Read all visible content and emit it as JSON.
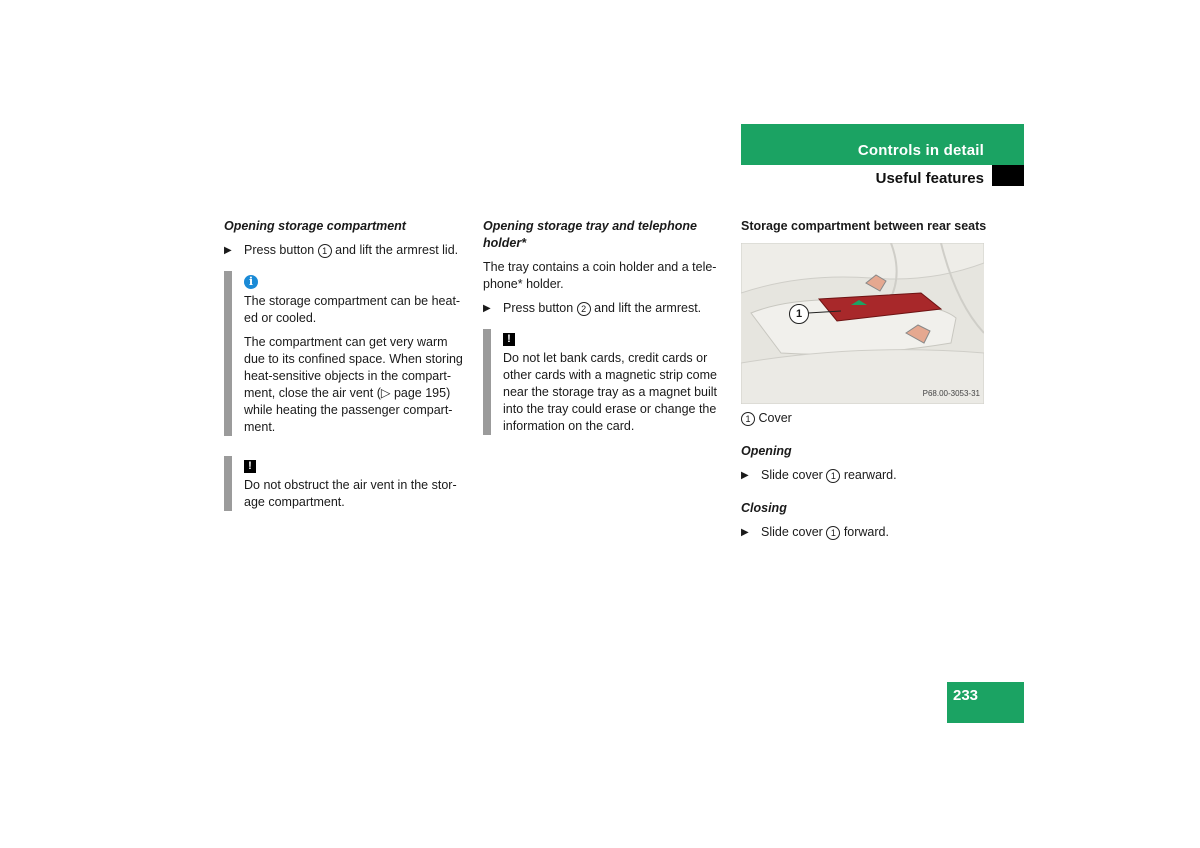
{
  "header": {
    "section": "Controls in detail",
    "subsection": "Useful features"
  },
  "column1": {
    "heading": "Opening storage compartment",
    "step1": {
      "before": "Press button",
      "num": "1",
      "after": "and lift the armrest lid."
    },
    "info_icon": "info-icon",
    "info_p1": "The storage compartment can be heat-ed or cooled.",
    "info_p2": "The compartment can get very warm due to its confined space. When storing heat-sensitive objects in the compart-ment, close the air vent (▷ page 195) while heating the passenger compart-ment.",
    "warning_icon": "!",
    "warning_text": "Do not obstruct the air vent in the stor-age compartment."
  },
  "column2": {
    "heading": "Opening storage tray and telephone holder*",
    "intro": "The tray contains a coin holder and a tele-phone* holder.",
    "step1": {
      "before": "Press button",
      "num": "2",
      "after": "and lift the armrest."
    },
    "warning_icon": "!",
    "warning_text": "Do not let bank cards, credit cards or other cards with a magnetic strip come near the storage tray as a magnet built into the tray could erase or change the information on the card."
  },
  "column3": {
    "heading": "Storage compartment between rear seats",
    "figure": {
      "callout": "1",
      "code": "P68.00-3053-31",
      "colors": {
        "cover": "#a8282a",
        "seat": "#e9e8e3",
        "symbol": "#1ba363"
      }
    },
    "legend": {
      "num": "1",
      "label": "Cover"
    },
    "opening_heading": "Opening",
    "opening_step": {
      "before": "Slide cover",
      "num": "1",
      "after": "rearward."
    },
    "closing_heading": "Closing",
    "closing_step": {
      "before": "Slide cover",
      "num": "1",
      "after": "forward."
    }
  },
  "page_number": "233",
  "colors": {
    "brand_green": "#1ba363",
    "note_bar": "#9b9b9b",
    "info_blue": "#1a8ad6"
  }
}
